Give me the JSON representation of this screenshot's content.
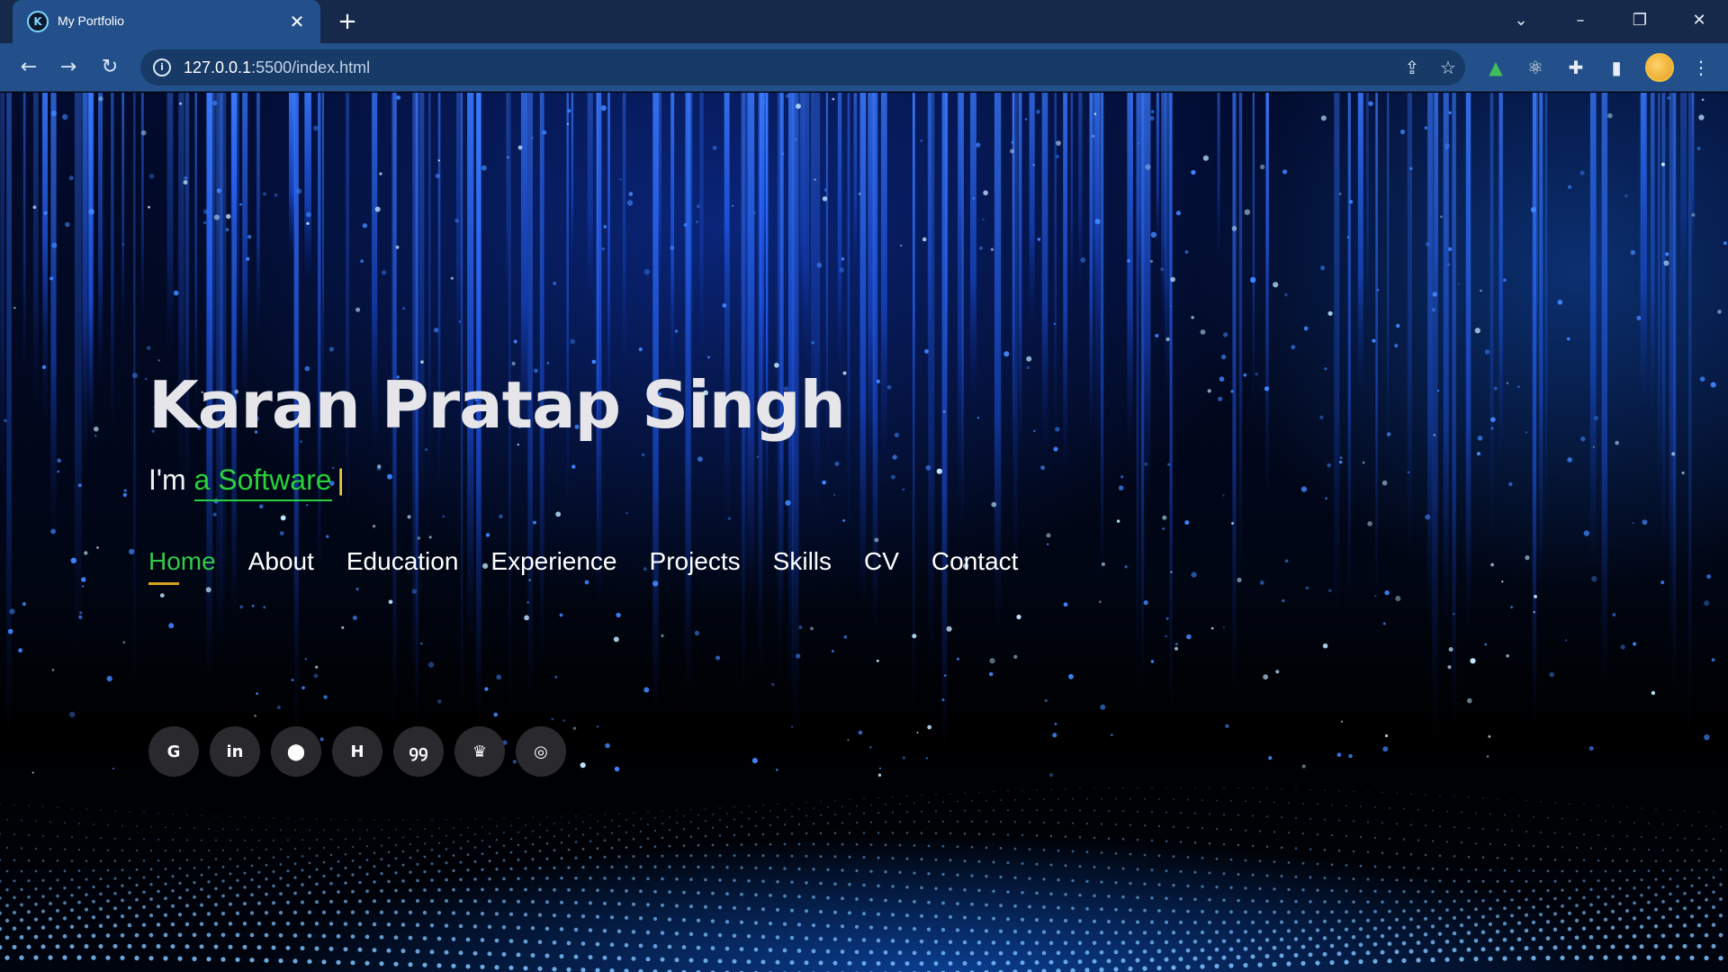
{
  "browser": {
    "tab_title": "My Portfolio",
    "tab_favicon": "K",
    "url_host": "127.0.0.1",
    "url_rest": ":5500/index.html"
  },
  "hero": {
    "name": "Karan Pratap Singh",
    "tagline_prefix": "I'm",
    "typed_text": "a Software",
    "cursor": "|"
  },
  "nav": {
    "items": [
      {
        "label": "Home",
        "active": true
      },
      {
        "label": "About"
      },
      {
        "label": "Education"
      },
      {
        "label": "Experience"
      },
      {
        "label": "Projects"
      },
      {
        "label": "Skills"
      },
      {
        "label": "CV"
      },
      {
        "label": "Contact"
      }
    ]
  },
  "socials": [
    {
      "icon": "google-icon",
      "glyph": "G"
    },
    {
      "icon": "linkedin-icon",
      "glyph": "in"
    },
    {
      "icon": "github-icon",
      "glyph": "⬤"
    },
    {
      "icon": "hackerrank-icon",
      "glyph": "H"
    },
    {
      "icon": "geeksforgeeks-icon",
      "glyph": "ꝯꝯ"
    },
    {
      "icon": "trophy-icon",
      "glyph": "♛"
    },
    {
      "icon": "instagram-icon",
      "glyph": "◎"
    }
  ],
  "colors": {
    "accent_green": "#2bd13b",
    "underline_gold": "#d7a21e",
    "browser_toolbar": "#23508a",
    "browser_tabstrip": "#16294a"
  }
}
